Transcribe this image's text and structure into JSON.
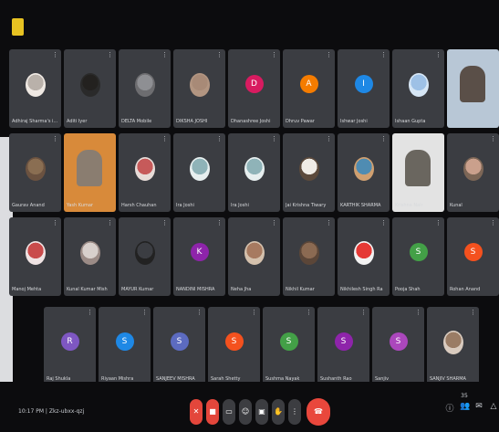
{
  "app": {
    "brand_color": "#e7c222"
  },
  "footer": {
    "meeting_info": "10:17 PM | Zkz-ubxx-qzj"
  },
  "tiles": [
    {
      "name": "Adhiraj Sharma's i...",
      "initial": "",
      "avatar_color": "#b9b1aa",
      "type": "photo",
      "tone": "#efe9e3"
    },
    {
      "name": "Aditi Iyer",
      "initial": "",
      "avatar_color": "#23211f",
      "type": "photo",
      "tone": "#2a2a2a"
    },
    {
      "name": "DELTA Mobile",
      "initial": "",
      "avatar_color": "#8e8f93",
      "type": "photo",
      "tone": "#6d6d70"
    },
    {
      "name": "DIKSHA JOSHI",
      "initial": "",
      "avatar_color": "#a88a77",
      "type": "photo",
      "tone": "#b29581"
    },
    {
      "name": "Dhanashree Joshi",
      "initial": "D",
      "avatar_color": "#d81b60",
      "type": "letter"
    },
    {
      "name": "Dhruv Pawar",
      "initial": "A",
      "avatar_color": "#f57c00",
      "type": "letter"
    },
    {
      "name": "Ishwar Joshi",
      "initial": "I",
      "avatar_color": "#1e88e5",
      "type": "letter"
    },
    {
      "name": "Ishaan Gupta",
      "initial": "",
      "avatar_color": "#9ec1e6",
      "type": "photo",
      "tone": "#d6e6f5"
    },
    {
      "name": "",
      "initial": "",
      "avatar_color": "",
      "type": "video",
      "tone": "#b8c7d6",
      "person": "#5a4f48"
    },
    {
      "name": "Gaurav Anand",
      "initial": "",
      "avatar_color": "#8a6e52",
      "type": "photo",
      "tone": "#6b5240"
    },
    {
      "name": "Yash Kumar",
      "initial": "",
      "avatar_color": "",
      "type": "video",
      "tone": "#d88a3a",
      "person": "#8a7d70"
    },
    {
      "name": "Harsh Chauhan",
      "initial": "",
      "avatar_color": "#c65a5a",
      "type": "photo",
      "tone": "#e7dcd8"
    },
    {
      "name": "Ira Joshi",
      "initial": "",
      "avatar_color": "#8fb3b8",
      "type": "photo",
      "tone": "#e7efef"
    },
    {
      "name": "Ira Joshi",
      "initial": "",
      "avatar_color": "#8fb3b8",
      "type": "photo",
      "tone": "#e7efef"
    },
    {
      "name": "Jai Krishna Tiwary",
      "initial": "",
      "avatar_color": "#f0ece6",
      "type": "photo",
      "tone": "#5c4a3c"
    },
    {
      "name": "KARTHIK SHARMA",
      "initial": "",
      "avatar_color": "#4f8cb2",
      "type": "photo",
      "tone": "#d0a070"
    },
    {
      "name": "Krishna Nair",
      "initial": "",
      "avatar_color": "",
      "type": "video",
      "tone": "#e3e3e3",
      "person": "#6a665f"
    },
    {
      "name": "Kunal",
      "initial": "",
      "avatar_color": "#caa08c",
      "type": "photo",
      "tone": "#7c6656"
    },
    {
      "name": "Manoj Mehta",
      "initial": "",
      "avatar_color": "#c94b4b",
      "type": "photo",
      "tone": "#efe3e3"
    },
    {
      "name": "Kunal Kumar Mish",
      "initial": "",
      "avatar_color": "#d8d0cc",
      "type": "photo",
      "tone": "#9b8b86"
    },
    {
      "name": "MAYUR Kumar",
      "initial": "",
      "avatar_color": "#3b3d42",
      "type": "photo",
      "tone": "#222"
    },
    {
      "name": "NANDINI MISHRA",
      "initial": "K",
      "avatar_color": "#8e24aa",
      "type": "letter"
    },
    {
      "name": "Neha Jha",
      "initial": "",
      "avatar_color": "#a77a60",
      "type": "photo",
      "tone": "#d4c1ad"
    },
    {
      "name": "Nikhil Kumar",
      "initial": "",
      "avatar_color": "#8b6a52",
      "type": "photo",
      "tone": "#5b4638"
    },
    {
      "name": "Nikhilesh Singh Ra",
      "initial": "",
      "avatar_color": "#e53935",
      "type": "photo",
      "tone": "#f2f2f2"
    },
    {
      "name": "Pooja Shah",
      "initial": "S",
      "avatar_color": "#43a047",
      "type": "letter"
    },
    {
      "name": "Rohan Anand",
      "initial": "S",
      "avatar_color": "#f4511e",
      "type": "letter"
    },
    {
      "name": "Raj Shukla",
      "initial": "R",
      "avatar_color": "#7e57c2",
      "type": "letter"
    },
    {
      "name": "Riyaan Mishra",
      "initial": "S",
      "avatar_color": "#1e88e5",
      "type": "letter"
    },
    {
      "name": "SANJEEV MISHRA",
      "initial": "S",
      "avatar_color": "#5c6bc0",
      "type": "letter"
    },
    {
      "name": "Sarah Shetty",
      "initial": "S",
      "avatar_color": "#f4511e",
      "type": "letter"
    },
    {
      "name": "Sushma Nayak",
      "initial": "S",
      "avatar_color": "#43a047",
      "type": "letter"
    },
    {
      "name": "Sushanth Rao",
      "initial": "S",
      "avatar_color": "#8e24aa",
      "type": "letter"
    },
    {
      "name": "Sanjiv",
      "initial": "S",
      "avatar_color": "#ab47bc",
      "type": "letter"
    },
    {
      "name": "SANJIV SHARMA",
      "initial": "",
      "avatar_color": "#9a7c65",
      "type": "photo",
      "tone": "#d9cbbf"
    }
  ],
  "controls": [
    {
      "icon": "mic-off-icon",
      "glyph": "✕",
      "danger": true
    },
    {
      "icon": "camera-off-icon",
      "glyph": "■",
      "danger": true
    },
    {
      "icon": "captions-icon",
      "glyph": "▭",
      "danger": false
    },
    {
      "icon": "emoji-icon",
      "glyph": "☺",
      "danger": false
    },
    {
      "icon": "present-icon",
      "glyph": "▣",
      "danger": false
    },
    {
      "icon": "raise-hand-icon",
      "glyph": "✋",
      "danger": false
    },
    {
      "icon": "more-options-icon",
      "glyph": "⋮",
      "danger": false
    }
  ],
  "end_call": {
    "icon": "end-call-icon",
    "glyph": "☎"
  },
  "right_icons": [
    {
      "icon": "info-icon",
      "glyph": "ⓘ",
      "count": ""
    },
    {
      "icon": "people-icon",
      "glyph": "👥",
      "count": "35"
    },
    {
      "icon": "chat-icon",
      "glyph": "✉",
      "count": ""
    },
    {
      "icon": "activities-icon",
      "glyph": "△",
      "count": ""
    }
  ]
}
